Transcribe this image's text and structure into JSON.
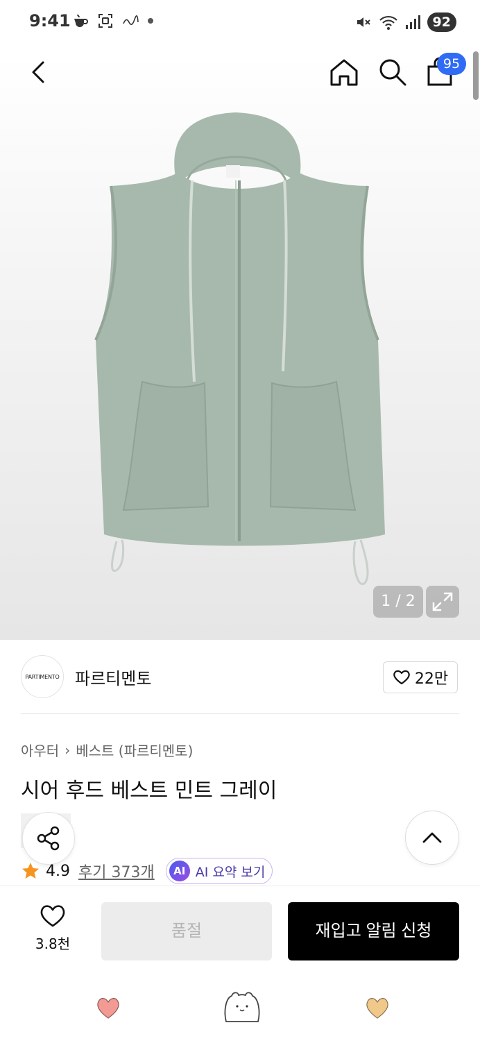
{
  "status_bar": {
    "time": "9:41",
    "battery": "92"
  },
  "nav": {
    "cart_count": "95"
  },
  "gallery": {
    "counter": "1 / 2"
  },
  "brand": {
    "logo_text": "PARTIMENTO",
    "name": "파르티멘토",
    "like_count": "22만"
  },
  "breadcrumb": {
    "category": "아우터",
    "separator": "›",
    "subcategory": "베스트 (파르티멘토)"
  },
  "product": {
    "title": "시어 후드 베스트 민트 그레이"
  },
  "rating": {
    "score": "4.9",
    "review_label": "후기 373개",
    "ai_badge": "AI",
    "ai_summary_label": "AI 요약 보기"
  },
  "actions": {
    "wish_count": "3.8천",
    "soldout_label": "품절",
    "restock_label": "재입고 알림 신청"
  },
  "colors": {
    "accent_blue": "#2f6bf5",
    "star": "#f5941e",
    "heart_pink": "#f29a93",
    "heart_yellow": "#f0c98a",
    "vest": "#a7b9ad"
  }
}
